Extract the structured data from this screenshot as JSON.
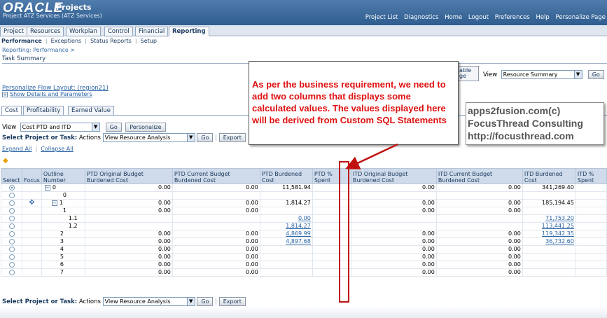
{
  "header": {
    "brand": "ORACLE",
    "product": "Projects",
    "responsibility": "Project ATZ Services (ATZ Services)",
    "global_links": [
      "Project List",
      "Diagnostics",
      "Home",
      "Logout",
      "Preferences",
      "Help",
      "Personalize Page"
    ]
  },
  "tabs": [
    {
      "label": "Project"
    },
    {
      "label": "Resources"
    },
    {
      "label": "Workplan"
    },
    {
      "label": "Control"
    },
    {
      "label": "Financial"
    },
    {
      "label": "Reporting"
    }
  ],
  "subtabs": [
    "Performance",
    "Exceptions",
    "Status Reports",
    "Setup"
  ],
  "breadcrumb": "Reporting: Performance >",
  "page_title": "Task Summary",
  "personalize_link": "Personalize Flow Layout: (region21)",
  "show_details_link": "Show Details and Parameters",
  "right_view": {
    "partial_button": "able ge",
    "label": "View",
    "value": "Resource Summary",
    "go": "Go"
  },
  "lower_tabs": [
    "Cost",
    "Profitability",
    "Earned Value"
  ],
  "view_row": {
    "label": "View",
    "value": "Cost PTD and ITD",
    "go": "Go",
    "personalize": "Personalize"
  },
  "action_row": {
    "label": "Select Project or Task:",
    "actions_label": "Actions",
    "value": "View Resource Analysis",
    "go": "Go",
    "export": "Export"
  },
  "expand_all": "Expand All",
  "collapse_all": "Collapse All",
  "columns": [
    "Select",
    "Focus",
    "Outline Number",
    "PTD Original Budget Burdened Cost",
    "PTD Current Budget Burdened Cost",
    "PTD Burdened Cost",
    "PTD % Spent",
    "ITD Original Budget Burdened Cost",
    "ITD Current Budget Burdened Cost",
    "ITD Burdened Cost",
    "ITD % Spent"
  ],
  "rows": [
    {
      "outline": "0",
      "tree": "−",
      "ptd_orig": "0.00",
      "ptd_curr": "0.00",
      "ptd_burd": "11,581.94",
      "itd_orig": "0.00",
      "itd_curr": "0.00",
      "itd_burd": "341,269.40"
    },
    {
      "outline": "0",
      "tree": "",
      "ptd_orig": "",
      "ptd_curr": "",
      "ptd_burd": "",
      "itd_orig": "",
      "itd_curr": "",
      "itd_burd": ""
    },
    {
      "outline": "1",
      "tree": "−",
      "ptd_orig": "0.00",
      "ptd_curr": "0.00",
      "ptd_burd": "1,814.27",
      "itd_orig": "0.00",
      "itd_curr": "0.00",
      "itd_burd": "185,194.45"
    },
    {
      "outline": "1",
      "tree": "",
      "ptd_orig": "0.00",
      "ptd_curr": "0.00",
      "ptd_burd": "",
      "itd_orig": "0.00",
      "itd_curr": "0.00",
      "itd_burd": ""
    },
    {
      "outline": "1.1",
      "tree": "",
      "ptd_orig": "",
      "ptd_curr": "",
      "ptd_burd": "0.00",
      "itd_orig": "",
      "itd_curr": "",
      "itd_burd": "71,753.20"
    },
    {
      "outline": "1.2",
      "tree": "",
      "ptd_orig": "",
      "ptd_curr": "",
      "ptd_burd": "1,814.27",
      "itd_orig": "",
      "itd_curr": "",
      "itd_burd": "113,441.25"
    },
    {
      "outline": "2",
      "tree": "",
      "ptd_orig": "0.00",
      "ptd_curr": "0.00",
      "ptd_burd": "4,869.99",
      "itd_orig": "0.00",
      "itd_curr": "0.00",
      "itd_burd": "119,342.35"
    },
    {
      "outline": "3",
      "tree": "",
      "ptd_orig": "0.00",
      "ptd_curr": "0.00",
      "ptd_burd": "4,897.68",
      "itd_orig": "0.00",
      "itd_curr": "0.00",
      "itd_burd": "36,732.60"
    },
    {
      "outline": "4",
      "tree": "",
      "ptd_orig": "0.00",
      "ptd_curr": "0.00",
      "ptd_burd": "",
      "itd_orig": "0.00",
      "itd_curr": "0.00",
      "itd_burd": ""
    },
    {
      "outline": "5",
      "tree": "",
      "ptd_orig": "0.00",
      "ptd_curr": "0.00",
      "ptd_burd": "",
      "itd_orig": "0.00",
      "itd_curr": "0.00",
      "itd_burd": ""
    },
    {
      "outline": "6",
      "tree": "",
      "ptd_orig": "0.00",
      "ptd_curr": "0.00",
      "ptd_burd": "",
      "itd_orig": "0.00",
      "itd_curr": "0.00",
      "itd_burd": ""
    },
    {
      "outline": "7",
      "tree": "",
      "ptd_orig": "0.00",
      "ptd_curr": "0.00",
      "ptd_burd": "",
      "itd_orig": "0.00",
      "itd_curr": "0.00",
      "itd_burd": ""
    }
  ],
  "callout": {
    "text": "As per the business requirement, we need to add two columns that displays some calculated values. The values displayed here will be derived from Custom SQL Statements",
    "color": "#e01010"
  },
  "watermark": [
    "apps2fusion.com(c)",
    "FocusThread Consulting",
    "http://focusthread.com"
  ]
}
